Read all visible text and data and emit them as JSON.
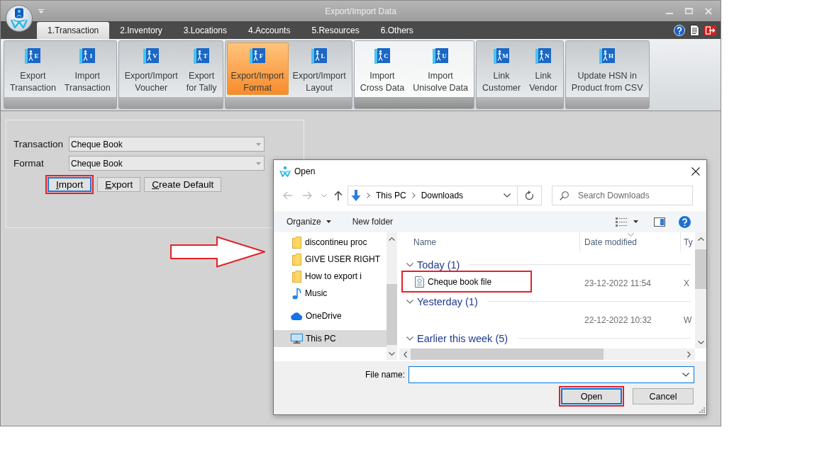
{
  "window": {
    "title": "Export/Import Data"
  },
  "tabs": [
    {
      "label": "1.Transaction",
      "selected": true
    },
    {
      "label": "2.Inventory",
      "selected": false
    },
    {
      "label": "3.Locations",
      "selected": false
    },
    {
      "label": "4.Accounts",
      "selected": false
    },
    {
      "label": "5.Resources",
      "selected": false
    },
    {
      "label": "6.Others",
      "selected": false
    }
  ],
  "ribbon": {
    "groups": [
      {
        "hovered": false,
        "buttons": [
          {
            "label": "Export\nTransaction",
            "icon_letter": "E",
            "selected": false
          },
          {
            "label": "Import\nTransaction",
            "icon_letter": "I",
            "selected": false
          }
        ]
      },
      {
        "hovered": false,
        "buttons": [
          {
            "label": "Export/Import\nVoucher",
            "icon_letter": "V",
            "selected": false
          },
          {
            "label": "Export\nfor Tally",
            "icon_letter": "T",
            "selected": false
          }
        ]
      },
      {
        "hovered": false,
        "buttons": [
          {
            "label": "Export/Import\nFormat",
            "icon_letter": "F",
            "selected": true
          },
          {
            "label": "Export/Import\nLayout",
            "icon_letter": "L",
            "selected": false
          }
        ]
      },
      {
        "hovered": true,
        "buttons": [
          {
            "label": "Import\nCross Data",
            "icon_letter": "C",
            "selected": false
          },
          {
            "label": "Import\nUnisolve Data",
            "icon_letter": "U",
            "selected": false
          }
        ]
      },
      {
        "hovered": false,
        "buttons": [
          {
            "label": "Link\nCustomer",
            "icon_letter": "M",
            "selected": false
          },
          {
            "label": "Link\nVendor",
            "icon_letter": "N",
            "selected": false
          }
        ]
      },
      {
        "hovered": false,
        "buttons": [
          {
            "label": "Update HSN in\nProduct from CSV",
            "icon_letter": "H",
            "selected": false
          }
        ]
      }
    ]
  },
  "form": {
    "fields": [
      {
        "label": "Transaction",
        "value": "Cheque Book"
      },
      {
        "label": "Format",
        "value": "Cheque Book"
      }
    ],
    "buttons": [
      {
        "label": "Import",
        "focused": true,
        "highlighted": true
      },
      {
        "label": "Export",
        "focused": false,
        "highlighted": false
      },
      {
        "label": "Create Default",
        "focused": false,
        "highlighted": false
      }
    ]
  },
  "annotations": [
    {
      "kind": "arrow"
    }
  ],
  "dialog": {
    "title": "Open",
    "back": {
      "disabled": true
    },
    "forward": {
      "disabled": true
    },
    "breadcrumb": [
      "This PC",
      "Downloads"
    ],
    "search": {
      "placeholder": "Search Downloads"
    },
    "toolbar": [
      {
        "label": "Organize",
        "kind": "menu"
      },
      {
        "label": "New folder",
        "kind": "button"
      }
    ],
    "nav": [
      {
        "label": "discontineu proc",
        "kind": "folder",
        "selected": false
      },
      {
        "label": "GIVE USER RIGHT",
        "kind": "folder",
        "selected": false
      },
      {
        "label": "How to export i",
        "kind": "folder",
        "selected": false
      },
      {
        "label": "Music",
        "kind": "music",
        "selected": false
      },
      {
        "label": "OneDrive",
        "kind": "cloud",
        "selected": false
      },
      {
        "label": "This PC",
        "kind": "computer",
        "selected": true
      }
    ],
    "columns": [
      {
        "label": "Name",
        "sorted": false
      },
      {
        "label": "Date modified",
        "sorted": true
      },
      {
        "label": "Ty",
        "sorted": false
      }
    ],
    "groups": [
      {
        "label": "Today (1)",
        "expanded": true,
        "files": [
          {
            "name": "Cheque book file",
            "date": "23-12-2022 11:54",
            "type": "X",
            "highlighted": true
          }
        ]
      },
      {
        "label": "Yesterday (1)",
        "expanded": true,
        "files": [
          {
            "date": "22-12-2022 10:32",
            "type": "W",
            "highlighted": false
          }
        ]
      },
      {
        "label": "Earlier this week (5)",
        "expanded": true
      }
    ],
    "file_name": {
      "label": "File name:"
    },
    "buttons": [
      {
        "label": "Open",
        "focused": true,
        "highlighted": true
      },
      {
        "label": "Cancel",
        "focused": false,
        "highlighted": false
      }
    ]
  }
}
